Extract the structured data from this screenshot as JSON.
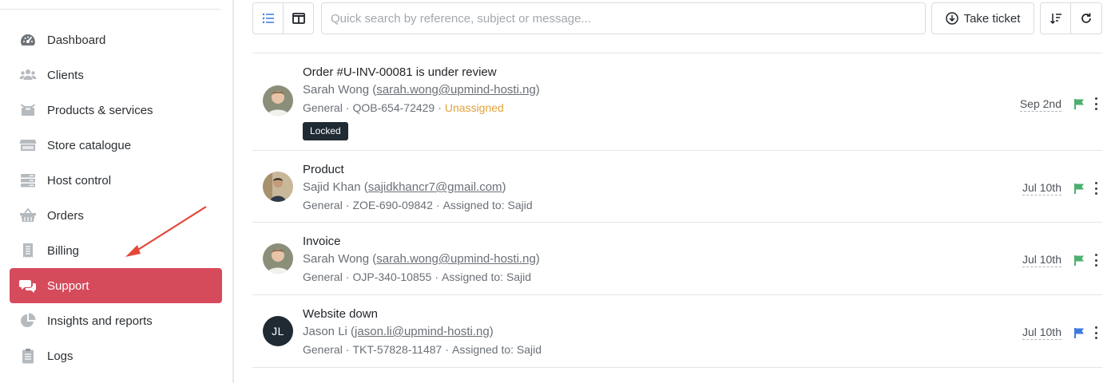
{
  "sidebar": {
    "items": [
      {
        "label": "Dashboard",
        "icon": "dashboard-gauge-icon",
        "active": false
      },
      {
        "label": "Clients",
        "icon": "users-icon",
        "active": false
      },
      {
        "label": "Products & services",
        "icon": "box-icon",
        "active": false
      },
      {
        "label": "Store catalogue",
        "icon": "store-icon",
        "active": false
      },
      {
        "label": "Host control",
        "icon": "server-icon",
        "active": false
      },
      {
        "label": "Orders",
        "icon": "basket-icon",
        "active": false
      },
      {
        "label": "Billing",
        "icon": "receipt-icon",
        "active": false
      },
      {
        "label": "Support",
        "icon": "chat-bubbles-icon",
        "active": true
      },
      {
        "label": "Insights and reports",
        "icon": "pie-chart-icon",
        "active": false
      },
      {
        "label": "Logs",
        "icon": "clipboard-icon",
        "active": false
      }
    ]
  },
  "toolbar": {
    "search_placeholder": "Quick search by reference, subject or message...",
    "take_ticket_label": "Take ticket"
  },
  "tickets": [
    {
      "subject": "Order #U-INV-00081 is under review",
      "name": "Sarah Wong",
      "email": "sarah.wong@upmind-hosti.ng",
      "department": "General",
      "reference": "QOB-654-72429",
      "assignment": "Unassigned",
      "badge": "Locked",
      "date": "Sep 2nd",
      "flag_color": "#4caf6e",
      "avatar": "photo"
    },
    {
      "subject": "Product",
      "name": "Sajid Khan",
      "email": "sajidkhancr7@gmail.com",
      "department": "General",
      "reference": "ZOE-690-09842",
      "assignment": "Assigned to: Sajid",
      "date": "Jul 10th",
      "flag_color": "#4caf6e",
      "avatar": "photo"
    },
    {
      "subject": "Invoice",
      "name": "Sarah Wong",
      "email": "sarah.wong@upmind-hosti.ng",
      "department": "General",
      "reference": "OJP-340-10855",
      "assignment": "Assigned to: Sajid",
      "date": "Jul 10th",
      "flag_color": "#4caf6e",
      "avatar": "photo"
    },
    {
      "subject": "Website down",
      "name": "Jason Li",
      "email": "jason.li@upmind-hosti.ng",
      "department": "General",
      "reference": "TKT-57828-11487",
      "assignment": "Assigned to: Sajid",
      "date": "Jul 10th",
      "flag_color": "#3d7be0",
      "avatar": "JL"
    }
  ],
  "colors": {
    "accent": "#d64b5c",
    "unassigned": "#e2a23c",
    "arrow": "#e5483a"
  }
}
